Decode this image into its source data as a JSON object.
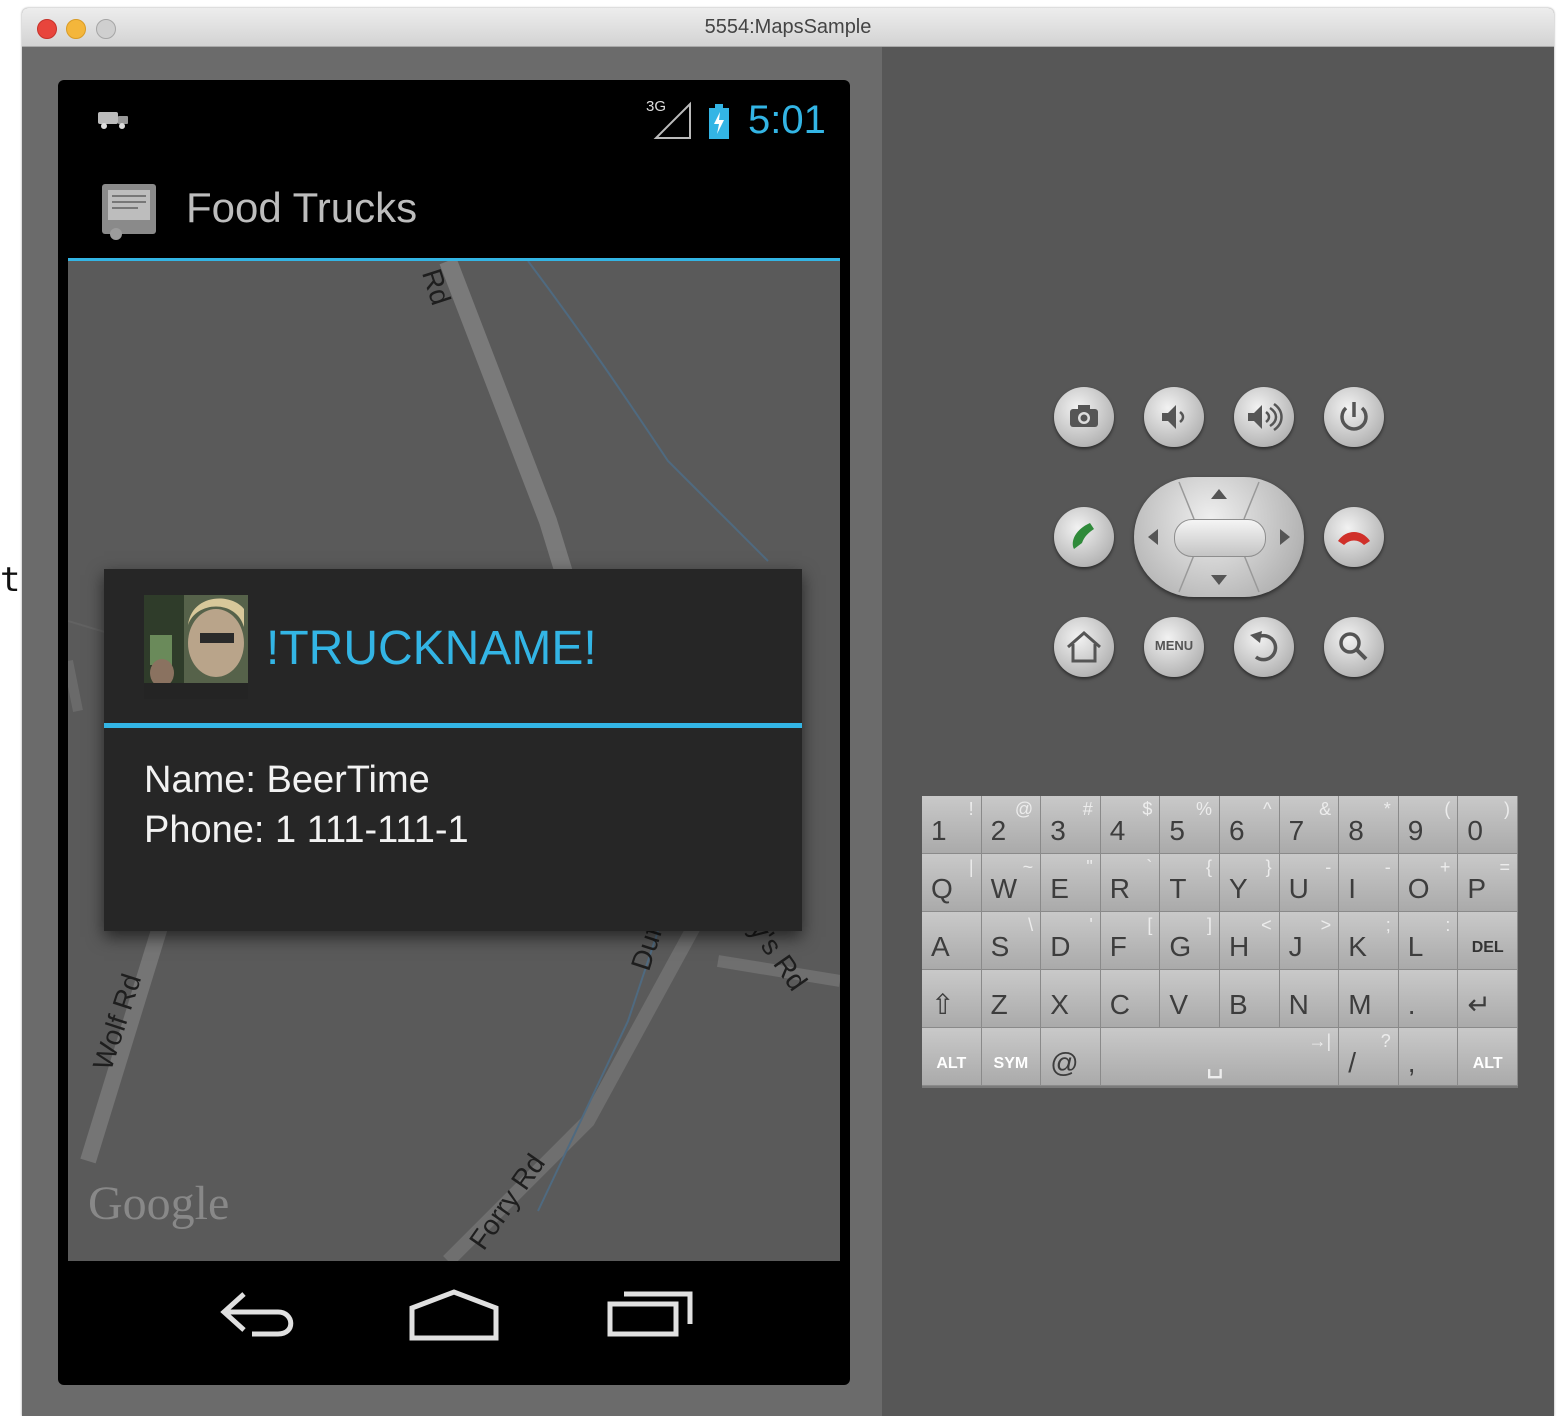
{
  "stray_glyph": "t",
  "window": {
    "title": "5554:MapsSample"
  },
  "status_bar": {
    "network": "3G",
    "time": "5:01"
  },
  "action_bar": {
    "title": "Food Trucks"
  },
  "map": {
    "road_labels": [
      "Rd",
      "Wolf Rd",
      "Duff H",
      "mmy's Rd",
      "Forry Rd"
    ],
    "attribution": "Google"
  },
  "info_window": {
    "title": "!TRUCKNAME!",
    "name_line": "Name: BeerTime",
    "phone_line": "Phone: 1 111-111-1"
  },
  "hardware_buttons": {
    "menu_label": "MENU"
  },
  "keyboard": {
    "rows": [
      [
        {
          "main": "1",
          "alt": "!"
        },
        {
          "main": "2",
          "alt": "@"
        },
        {
          "main": "3",
          "alt": "#"
        },
        {
          "main": "4",
          "alt": "$"
        },
        {
          "main": "5",
          "alt": "%"
        },
        {
          "main": "6",
          "alt": "^"
        },
        {
          "main": "7",
          "alt": "&"
        },
        {
          "main": "8",
          "alt": "*"
        },
        {
          "main": "9",
          "alt": "("
        },
        {
          "main": "0",
          "alt": ")"
        }
      ],
      [
        {
          "main": "Q",
          "alt": "|"
        },
        {
          "main": "W",
          "alt": "~"
        },
        {
          "main": "E",
          "alt": "\""
        },
        {
          "main": "R",
          "alt": "`"
        },
        {
          "main": "T",
          "alt": "{"
        },
        {
          "main": "Y",
          "alt": "}"
        },
        {
          "main": "U",
          "alt": "-"
        },
        {
          "main": "I",
          "alt": "-"
        },
        {
          "main": "O",
          "alt": "+"
        },
        {
          "main": "P",
          "alt": "="
        }
      ],
      [
        {
          "main": "A",
          "alt": ""
        },
        {
          "main": "S",
          "alt": "\\"
        },
        {
          "main": "D",
          "alt": "'"
        },
        {
          "main": "F",
          "alt": "["
        },
        {
          "main": "G",
          "alt": "]"
        },
        {
          "main": "H",
          "alt": "<"
        },
        {
          "main": "J",
          "alt": ">"
        },
        {
          "main": "K",
          "alt": ";"
        },
        {
          "main": "L",
          "alt": ":"
        },
        {
          "main": "DEL",
          "alt": ""
        }
      ],
      [
        {
          "main": "⇧",
          "alt": ""
        },
        {
          "main": "Z",
          "alt": ""
        },
        {
          "main": "X",
          "alt": ""
        },
        {
          "main": "C",
          "alt": ""
        },
        {
          "main": "V",
          "alt": ""
        },
        {
          "main": "B",
          "alt": ""
        },
        {
          "main": "N",
          "alt": ""
        },
        {
          "main": "M",
          "alt": ""
        },
        {
          "main": ".",
          "alt": ""
        },
        {
          "main": "↵",
          "alt": ""
        }
      ],
      [
        {
          "main": "ALT",
          "alt": ""
        },
        {
          "main": "SYM",
          "alt": ""
        },
        {
          "main": "@",
          "alt": ""
        },
        {
          "main": "␣",
          "alt": "→|"
        },
        {
          "main": "/",
          "alt": "?"
        },
        {
          "main": ",",
          "alt": ""
        },
        {
          "main": "ALT",
          "alt": ""
        }
      ]
    ]
  },
  "colors": {
    "accent": "#33b5e5",
    "window_bg": "#6a6a6a",
    "map_bg": "#5a5a5a"
  }
}
